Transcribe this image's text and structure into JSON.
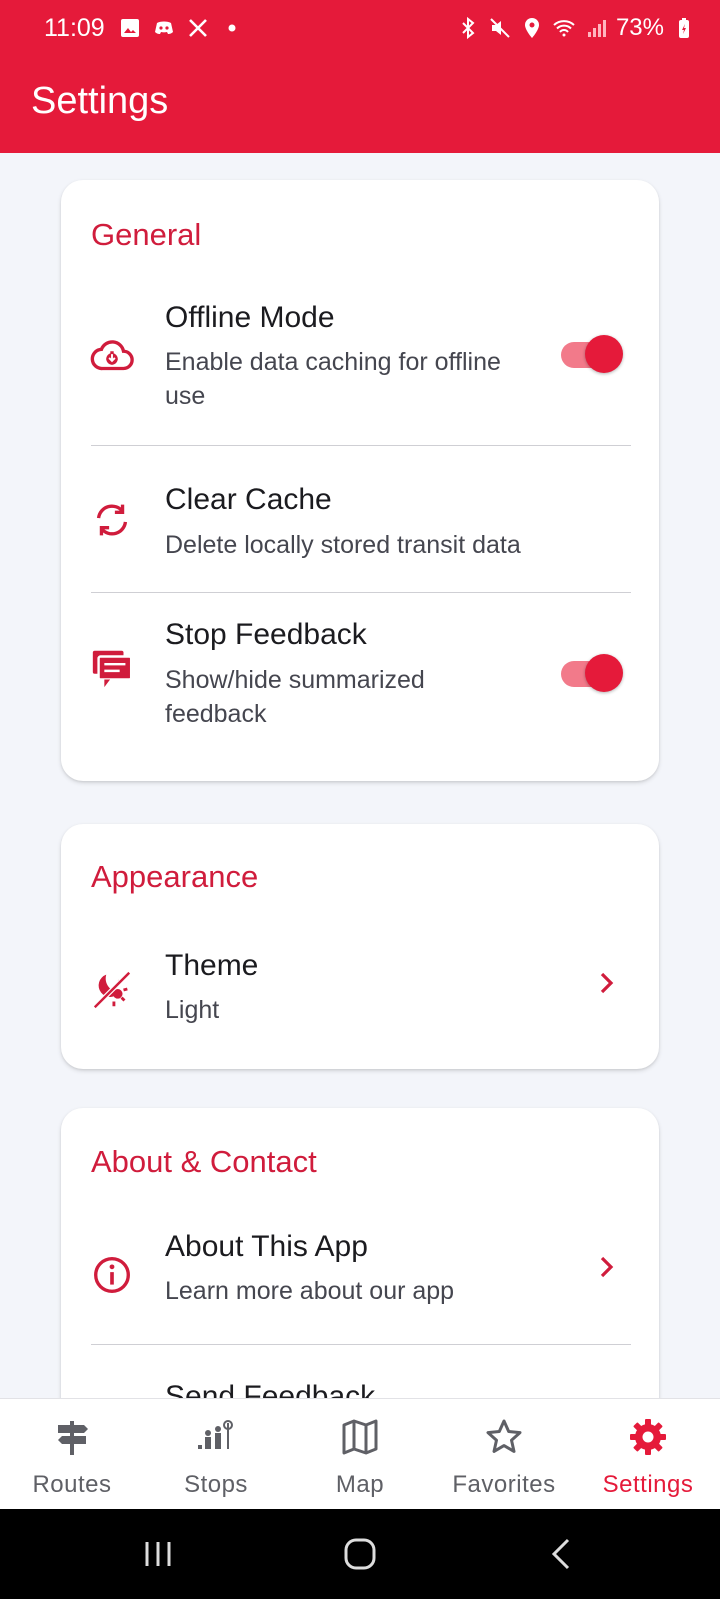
{
  "status_bar": {
    "time": "11:09",
    "battery": "73%",
    "left_icons": [
      "image-icon",
      "discord-icon",
      "x-icon",
      "dot-icon"
    ],
    "right_icons": [
      "bluetooth-icon",
      "mute-icon",
      "location-icon",
      "wifi-icon",
      "signal-icon",
      "battery-icon"
    ]
  },
  "header": {
    "title": "Settings"
  },
  "colors": {
    "accent": "#e51a3a",
    "section": "#d01c3c",
    "background": "#f3f5fa"
  },
  "sections": {
    "general": {
      "title": "General",
      "offline": {
        "title": "Offline Mode",
        "subtitle": "Enable data caching for offline use",
        "icon": "cloud-download-icon",
        "enabled": true
      },
      "cache": {
        "title": "Clear Cache",
        "subtitle": "Delete locally stored transit data",
        "icon": "refresh-icon"
      },
      "feedback": {
        "title": "Stop Feedback",
        "subtitle": "Show/hide summarized feedback",
        "icon": "feedback-icon",
        "enabled": true
      }
    },
    "appearance": {
      "title": "Appearance",
      "theme": {
        "title": "Theme",
        "subtitle": "Light",
        "icon": "theme-icon"
      }
    },
    "about": {
      "title": "About & Contact",
      "about_app": {
        "title": "About This App",
        "subtitle": "Learn more about our app",
        "icon": "info-icon"
      },
      "send_feedback": {
        "title": "Send Feedback"
      }
    }
  },
  "bottom_nav": [
    {
      "label": "Routes",
      "icon": "signpost-icon",
      "active": false
    },
    {
      "label": "Stops",
      "icon": "people-stop-icon",
      "active": false
    },
    {
      "label": "Map",
      "icon": "map-icon",
      "active": false
    },
    {
      "label": "Favorites",
      "icon": "star-icon",
      "active": false
    },
    {
      "label": "Settings",
      "icon": "gear-icon",
      "active": true
    }
  ]
}
